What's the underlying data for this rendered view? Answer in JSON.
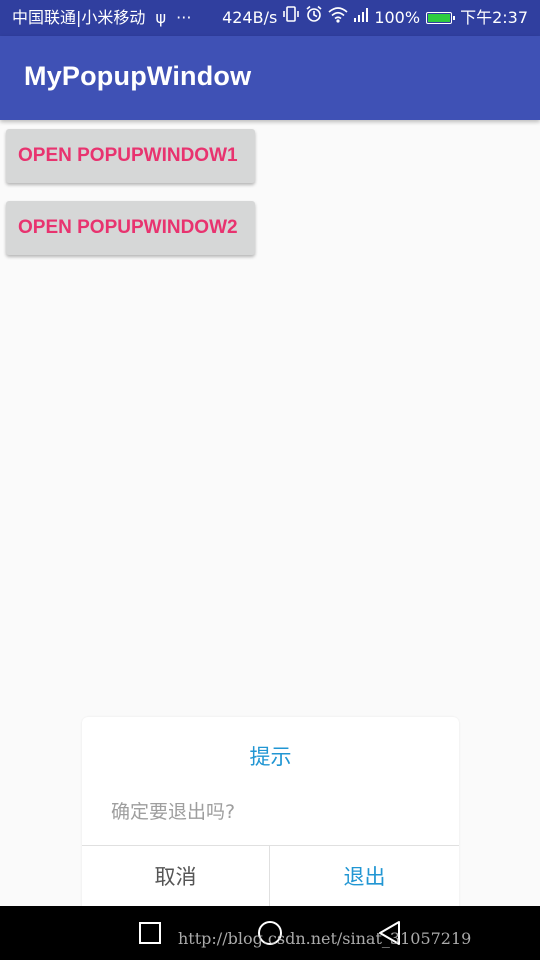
{
  "status_bar": {
    "carrier": "中国联通|小米移动",
    "usb_symbol": "ψ",
    "more": "···",
    "speed": "424B/s",
    "network_type": "4G",
    "battery_percent": "100%",
    "battery_level": 1.0,
    "time": "下午2:37",
    "icons": [
      "usb-icon",
      "vibrate-icon",
      "alarm-icon",
      "wifi-icon",
      "signal-icon",
      "battery-icon"
    ]
  },
  "app_bar": {
    "title": "MyPopupWindow",
    "color": "#3f51b5"
  },
  "buttons": [
    {
      "label": "OPEN POPUPWINDOW1"
    },
    {
      "label": "OPEN POPUPWINDOW2"
    }
  ],
  "dialog": {
    "title": "提示",
    "message": "确定要退出吗?",
    "cancel_label": "取消",
    "confirm_label": "退出",
    "accent_color": "#2196d3"
  },
  "nav_bar": {
    "icons": [
      "recent-apps-icon",
      "home-icon",
      "back-icon"
    ]
  },
  "watermark": "http://blog.csdn.net/sinat_31057219",
  "colors": {
    "status_bar": "#303f9f",
    "button_text": "#e8336f",
    "button_bg": "#d6d7d7"
  }
}
